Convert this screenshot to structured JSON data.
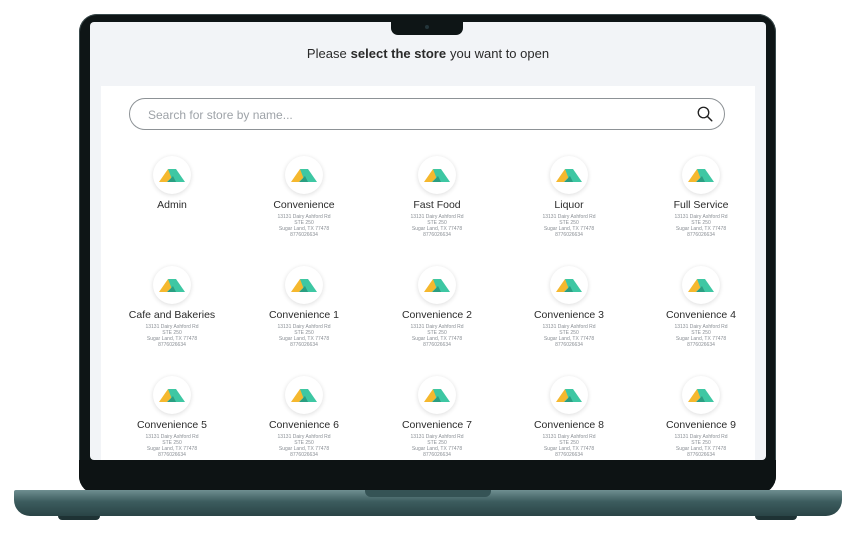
{
  "header": {
    "prefix": "Please",
    "emphasis": "select the store",
    "suffix": "you want to open"
  },
  "search": {
    "placeholder": "Search for store by name...",
    "icon": "search-icon"
  },
  "stores": [
    {
      "name": "Admin",
      "address": []
    },
    {
      "name": "Convenience",
      "address": [
        "13131 Dairy Ashford Rd",
        "STE 250",
        "Sugar Land, TX 77478",
        "8776026634"
      ]
    },
    {
      "name": "Fast Food",
      "address": [
        "13131 Dairy Ashford Rd",
        "STE 250",
        "Sugar Land, TX 77478",
        "8776026634"
      ]
    },
    {
      "name": "Liquor",
      "address": [
        "13131 Dairy Ashford Rd",
        "STE 250",
        "Sugar Land, TX 77478",
        "8776026634"
      ]
    },
    {
      "name": "Full Service",
      "address": [
        "13131 Dairy Ashford Rd",
        "STE 250",
        "Sugar Land, TX 77478",
        "8776026634"
      ]
    },
    {
      "name": "Cafe and Bakeries",
      "address": [
        "13131 Dairy Ashford Rd",
        "STE 250",
        "Sugar Land, TX 77478",
        "8776026634"
      ]
    },
    {
      "name": "Convenience 1",
      "address": [
        "13131 Dairy Ashford Rd",
        "STE 250",
        "Sugar Land, TX 77478",
        "8776026634"
      ]
    },
    {
      "name": "Convenience 2",
      "address": [
        "13131 Dairy Ashford Rd",
        "STE 250",
        "Sugar Land, TX 77478",
        "8776026634"
      ]
    },
    {
      "name": "Convenience 3",
      "address": [
        "13131 Dairy Ashford Rd",
        "STE 250",
        "Sugar Land, TX 77478",
        "8776026634"
      ]
    },
    {
      "name": "Convenience 4",
      "address": [
        "13131 Dairy Ashford Rd",
        "STE 250",
        "Sugar Land, TX 77478",
        "8776026634"
      ]
    },
    {
      "name": "Convenience 5",
      "address": [
        "13131 Dairy Ashford Rd",
        "STE 250",
        "Sugar Land, TX 77478",
        "8776026634"
      ]
    },
    {
      "name": "Convenience 6",
      "address": [
        "13131 Dairy Ashford Rd",
        "STE 250",
        "Sugar Land, TX 77478",
        "8776026634"
      ]
    },
    {
      "name": "Convenience 7",
      "address": [
        "13131 Dairy Ashford Rd",
        "STE 250",
        "Sugar Land, TX 77478",
        "8776026634"
      ]
    },
    {
      "name": "Convenience 8",
      "address": [
        "13131 Dairy Ashford Rd",
        "STE 250",
        "Sugar Land, TX 77478",
        "8776026634"
      ]
    },
    {
      "name": "Convenience 9",
      "address": [
        "13131 Dairy Ashford Rd",
        "STE 250",
        "Sugar Land, TX 77478",
        "8776026634"
      ]
    }
  ],
  "colors": {
    "logo_yellow": "#f5b82e",
    "logo_teal": "#3ec7a3",
    "laptop_body": "#3c5c5e"
  }
}
